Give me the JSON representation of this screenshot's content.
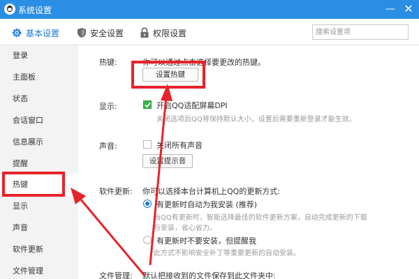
{
  "window": {
    "title": "系统设置",
    "minimize_glyph": "—",
    "close_glyph": "✕"
  },
  "tabs": {
    "basic": {
      "label": "基本设置",
      "icon": "gear-icon"
    },
    "security": {
      "label": "安全设置",
      "icon": "shield-icon"
    },
    "permission": {
      "label": "权限设置",
      "icon": "lock-icon"
    }
  },
  "search": {
    "placeholder": "搜索设置项"
  },
  "sidebar": {
    "items": [
      {
        "label": "登录"
      },
      {
        "label": "主面板"
      },
      {
        "label": "状态"
      },
      {
        "label": "会话窗口"
      },
      {
        "label": "信息展示"
      },
      {
        "label": "提醒"
      },
      {
        "label": "热键"
      },
      {
        "label": "显示"
      },
      {
        "label": "声音"
      },
      {
        "label": "软件更新"
      },
      {
        "label": "文件管理"
      }
    ],
    "active_index": 6
  },
  "hotkey": {
    "label": "热键:",
    "description": "你可以通过点击选择要更改的热键。",
    "button": "设置热键"
  },
  "display": {
    "label": "显示:",
    "checkbox_label": "开启QQ适配屏幕DPI",
    "checked": true,
    "hint": "关闭选项后QQ将保持默认大小，设置后需要重新登录才能生效。"
  },
  "sound": {
    "label": "声音:",
    "checkbox_label": "关闭所有声音",
    "checked": false,
    "button": "设置提示音"
  },
  "update": {
    "label": "软件更新:",
    "description": "你可以选择本台计算机上QQ的更新方式:",
    "option1": {
      "label": "有更新时自动为我安装 (推荐)",
      "hint_line1": "当QQ有更新时，智能选择最佳的软件更新方案，自动完成更新的下载",
      "hint_line2": "与安装，省心省力。",
      "selected": true
    },
    "option2": {
      "label": "有更新时不要安装，但提醒我",
      "hint": "此方式不影响安全补丁等重要更新的自动安装。",
      "selected": false
    }
  },
  "file_mgmt": {
    "label": "文件管理:",
    "description": "默认把接收到的文件保存到此文件夹中:"
  },
  "colors": {
    "titlebar": "#2b8ee5",
    "accent": "#1a7ad9",
    "annotation": "#e8222a",
    "check": "#3cb34a"
  }
}
